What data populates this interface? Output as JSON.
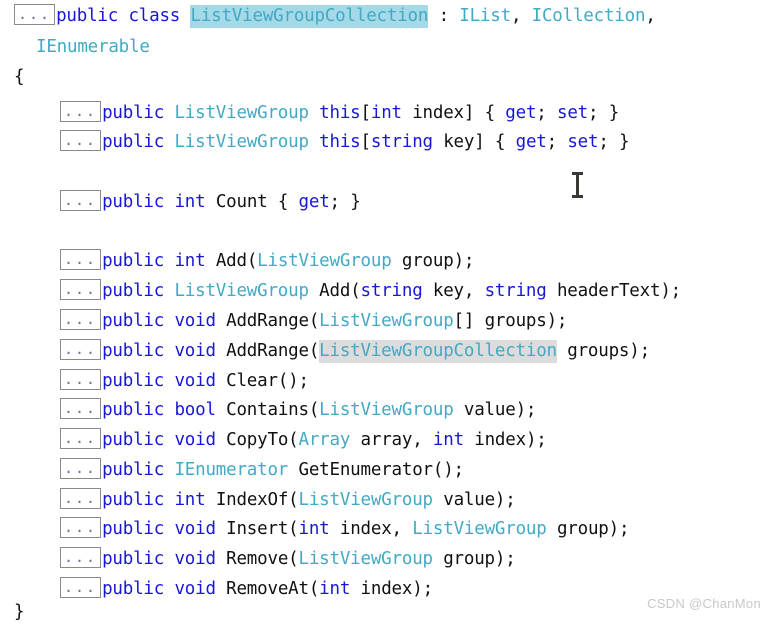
{
  "watermark": "CSDN @ChanMon",
  "colors": {
    "keyword": "#1717d6",
    "type": "#43a9c4",
    "identifier": "#111111",
    "selection_primary": "#a4d9e8",
    "selection_secondary": "#dcdcdc",
    "background": "#ffffff",
    "ellipsis_border": "#8a8a8a"
  },
  "ellipsis": "...",
  "code": {
    "line01": {
      "kw_public": "public",
      "kw_class": "class",
      "selected_type": "ListViewGroupCollection",
      "colon": ":",
      "iface_ilist": "IList",
      "comma1": ",",
      "iface_icollection": "ICollection",
      "comma2": ","
    },
    "line02": {
      "iface_ienumerable": "IEnumerable"
    },
    "line03": {
      "brace_open": "{"
    },
    "line04": {
      "kw_public": "public",
      "type": "ListViewGroup",
      "kw_this": "this",
      "bracket_open": "[",
      "kw_int": "int",
      "param": "index",
      "bracket_close": "]",
      "accessors_open": "{",
      "kw_get": "get",
      "semi1": ";",
      "kw_set": "set",
      "semi2": ";",
      "accessors_close": "}"
    },
    "line05": {
      "kw_public": "public",
      "type": "ListViewGroup",
      "kw_this": "this",
      "bracket_open": "[",
      "kw_string": "string",
      "param": "key",
      "bracket_close": "]",
      "accessors_open": "{",
      "kw_get": "get",
      "semi1": ";",
      "kw_set": "set",
      "semi2": ";",
      "accessors_close": "}"
    },
    "line06": {
      "kw_public": "public",
      "kw_int": "int",
      "name": "Count",
      "accessors_open": "{",
      "kw_get": "get",
      "semi": ";",
      "accessors_close": "}"
    },
    "line07": {
      "kw_public": "public",
      "kw_int": "int",
      "name": "Add",
      "paren_open": "(",
      "type": "ListViewGroup",
      "param": "group",
      "paren_close": ")",
      "semi": ";"
    },
    "line08": {
      "kw_public": "public",
      "type": "ListViewGroup",
      "name": "Add",
      "paren_open": "(",
      "kw_string1": "string",
      "param1": "key",
      "comma": ",",
      "kw_string2": "string",
      "param2": "headerText",
      "paren_close": ")",
      "semi": ";"
    },
    "line09": {
      "kw_public": "public",
      "kw_void": "void",
      "name": "AddRange",
      "paren_open": "(",
      "type": "ListViewGroup",
      "array_brackets": "[]",
      "param": "groups",
      "paren_close": ")",
      "semi": ";"
    },
    "line10": {
      "kw_public": "public",
      "kw_void": "void",
      "name": "AddRange",
      "paren_open": "(",
      "highlighted_type": "ListViewGroupCollection",
      "param": "groups",
      "paren_close": ")",
      "semi": ";"
    },
    "line11": {
      "kw_public": "public",
      "kw_void": "void",
      "name": "Clear",
      "parens": "()",
      "semi": ";"
    },
    "line12": {
      "kw_public": "public",
      "kw_bool": "bool",
      "name": "Contains",
      "paren_open": "(",
      "type": "ListViewGroup",
      "param": "value",
      "paren_close": ")",
      "semi": ";"
    },
    "line13": {
      "kw_public": "public",
      "kw_void": "void",
      "name": "CopyTo",
      "paren_open": "(",
      "type": "Array",
      "param1": "array",
      "comma": ",",
      "kw_int": "int",
      "param2": "index",
      "paren_close": ")",
      "semi": ";"
    },
    "line14": {
      "kw_public": "public",
      "type": "IEnumerator",
      "name": "GetEnumerator",
      "parens": "()",
      "semi": ";"
    },
    "line15": {
      "kw_public": "public",
      "kw_int": "int",
      "name": "IndexOf",
      "paren_open": "(",
      "type": "ListViewGroup",
      "param": "value",
      "paren_close": ")",
      "semi": ";"
    },
    "line16": {
      "kw_public": "public",
      "kw_void": "void",
      "name": "Insert",
      "paren_open": "(",
      "kw_int": "int",
      "param1": "index",
      "comma": ",",
      "type": "ListViewGroup",
      "param2": "group",
      "paren_close": ")",
      "semi": ";"
    },
    "line17": {
      "kw_public": "public",
      "kw_void": "void",
      "name": "Remove",
      "paren_open": "(",
      "type": "ListViewGroup",
      "param": "group",
      "paren_close": ")",
      "semi": ";"
    },
    "line18": {
      "kw_public": "public",
      "kw_void": "void",
      "name": "RemoveAt",
      "paren_open": "(",
      "kw_int": "int",
      "param": "index",
      "paren_close": ")",
      "semi": ";"
    },
    "line19": {
      "brace_close": "}"
    }
  }
}
